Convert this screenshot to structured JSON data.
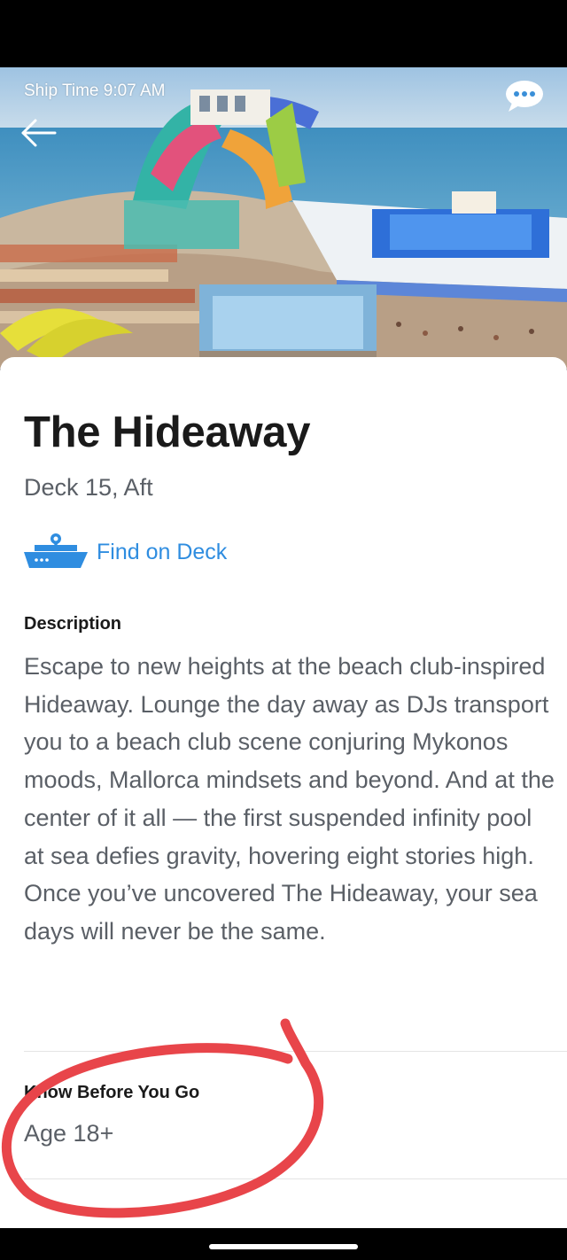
{
  "status": {
    "ship_time": "Ship Time 9:07 AM"
  },
  "venue": {
    "title": "The Hideaway",
    "location": "Deck 15, Aft",
    "find_on_deck": "Find on Deck"
  },
  "description": {
    "label": "Description",
    "text": "Escape to new heights at the beach club-inspired Hideaway. Lounge the day away as DJs transport you to a beach club scene conjuring Mykonos moods, Mallorca mindsets and beyond. And at the center of it all — the first suspended infinity pool at sea defies gravity, hovering eight stories high. Once you’ve uncovered The Hideaway, your sea days will never be the same."
  },
  "know_before_you_go": {
    "label": "Know Before You Go",
    "age": "Age 18+"
  },
  "icons": {
    "back": "arrow-left-icon",
    "chat": "chat-bubble-icon",
    "ship": "ship-location-icon"
  },
  "colors": {
    "accent": "#2f8de0",
    "annotation": "#e8454a",
    "text_primary": "#1a1a1a",
    "text_secondary": "#5a5f66"
  }
}
